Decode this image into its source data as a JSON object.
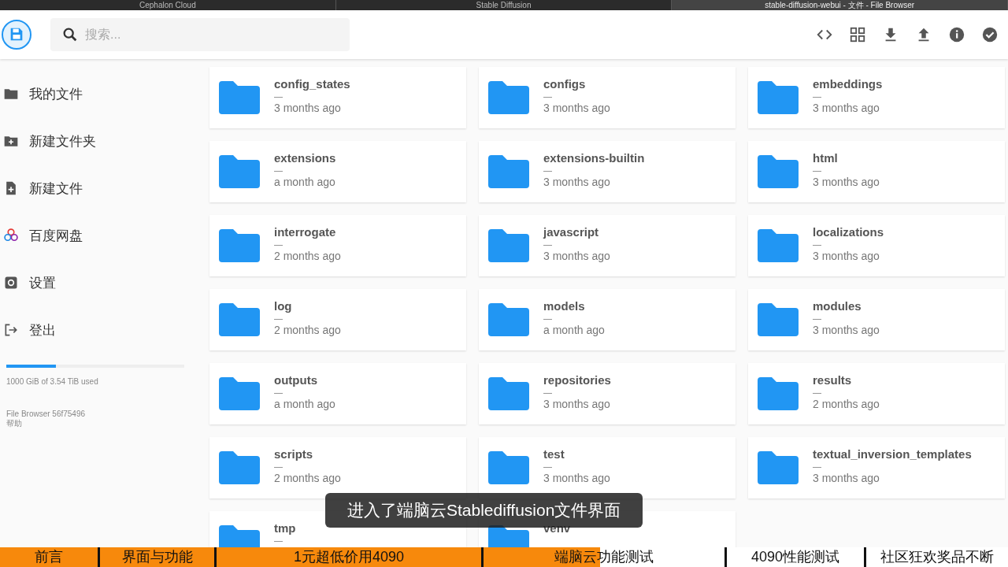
{
  "browser_tabs": [
    {
      "title": "Cephalon Cloud",
      "selected": false
    },
    {
      "title": "Stable Diffusion",
      "selected": false
    },
    {
      "title": "stable-diffusion-webui - 文件 - File Browser",
      "selected": true
    }
  ],
  "search": {
    "placeholder": "搜索..."
  },
  "toolbar": [
    {
      "kind": "code"
    },
    {
      "kind": "grid"
    },
    {
      "kind": "download"
    },
    {
      "kind": "upload"
    },
    {
      "kind": "info"
    },
    {
      "kind": "check"
    }
  ],
  "sidebar": {
    "items": [
      {
        "label": "我的文件",
        "kind": "folder"
      },
      {
        "label": "新建文件夹",
        "kind": "new-folder"
      },
      {
        "label": "新建文件",
        "kind": "new-file"
      },
      {
        "label": "百度网盘",
        "kind": "cloud"
      },
      {
        "label": "设置",
        "kind": "settings"
      },
      {
        "label": "登出",
        "kind": "logout"
      }
    ],
    "storage": {
      "level": 0.28,
      "text": "1000 GiB of 3.54 TiB used"
    },
    "version": "File Browser 56f75496",
    "help": "帮助"
  },
  "files": [
    {
      "name": "config_states",
      "size": "—",
      "modified": "3 months ago"
    },
    {
      "name": "configs",
      "size": "—",
      "modified": "3 months ago"
    },
    {
      "name": "embeddings",
      "size": "—",
      "modified": "3 months ago"
    },
    {
      "name": "extensions",
      "size": "—",
      "modified": "a month ago"
    },
    {
      "name": "extensions-builtin",
      "size": "—",
      "modified": "3 months ago"
    },
    {
      "name": "html",
      "size": "—",
      "modified": "3 months ago"
    },
    {
      "name": "interrogate",
      "size": "—",
      "modified": "2 months ago"
    },
    {
      "name": "javascript",
      "size": "—",
      "modified": "3 months ago"
    },
    {
      "name": "localizations",
      "size": "—",
      "modified": "3 months ago"
    },
    {
      "name": "log",
      "size": "—",
      "modified": "2 months ago"
    },
    {
      "name": "models",
      "size": "—",
      "modified": "a month ago"
    },
    {
      "name": "modules",
      "size": "—",
      "modified": "3 months ago"
    },
    {
      "name": "outputs",
      "size": "—",
      "modified": "a month ago"
    },
    {
      "name": "repositories",
      "size": "—",
      "modified": "3 months ago"
    },
    {
      "name": "results",
      "size": "—",
      "modified": "2 months ago"
    },
    {
      "name": "scripts",
      "size": "—",
      "modified": "2 months ago"
    },
    {
      "name": "test",
      "size": "—",
      "modified": "3 months ago"
    },
    {
      "name": "textual_inversion_templates",
      "size": "—",
      "modified": "3 months ago"
    },
    {
      "name": "tmp",
      "size": "—"
    },
    {
      "name": "venv"
    }
  ],
  "subtitle": "进入了端脑云Stablediffusion文件界面",
  "chapters": {
    "level": 0.595,
    "items": [
      "前言",
      "界面与功能",
      "1元超低价用4090",
      "端脑云功能测试",
      "4090性能测试",
      "社区狂欢奖品不断"
    ]
  }
}
